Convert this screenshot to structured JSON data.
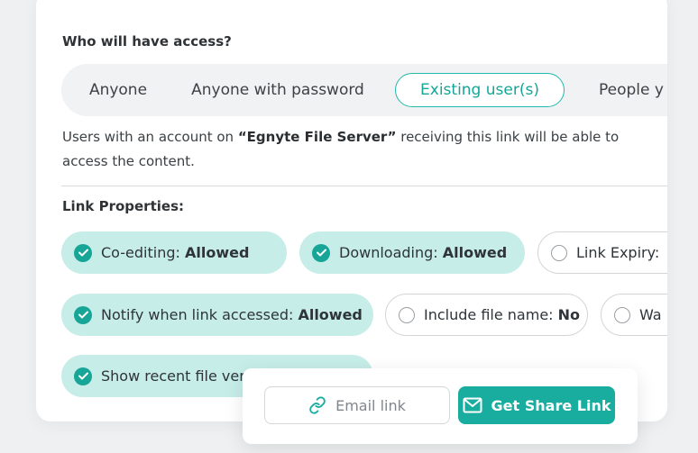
{
  "access": {
    "heading": "Who will have access?",
    "options": [
      {
        "label": "Anyone"
      },
      {
        "label": "Anyone with password"
      },
      {
        "label": "Existing user(s)",
        "selected": true
      },
      {
        "label": "People y"
      }
    ],
    "description": {
      "prefix": "Users with an account on ",
      "server": "“Egnyte File Server”",
      "suffix": " receiving this link will be able to access the content."
    }
  },
  "properties": {
    "label": "Link Properties:",
    "chips": [
      {
        "label": "Co-editing: ",
        "value": "Allowed",
        "checked": true
      },
      {
        "label": "Downloading: ",
        "value": "Allowed",
        "checked": true
      },
      {
        "label": "Link Expiry:",
        "value": "",
        "checked": false
      },
      {
        "label": "Notify when link accessed: ",
        "value": "Allowed",
        "checked": true
      },
      {
        "label": "Include file name: ",
        "value": "No",
        "checked": false
      },
      {
        "label": "Wa",
        "value": "",
        "checked": false
      },
      {
        "label": "Show recent file ver",
        "value": "",
        "checked": true
      }
    ]
  },
  "footer": {
    "email_label": "Email link",
    "share_label": "Get Share Link"
  },
  "colors": {
    "accent": "#19ada0",
    "chip_on_bg": "#c7ede9",
    "selected_border": "#24b8aa"
  }
}
